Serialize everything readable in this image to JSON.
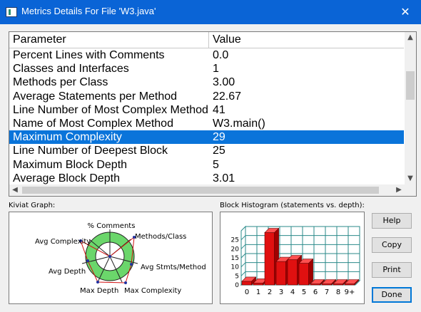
{
  "window": {
    "title": "Metrics Details For File 'W3.java'",
    "close_glyph": "✕"
  },
  "table": {
    "headers": {
      "parameter": "Parameter",
      "value": "Value"
    },
    "rows": [
      {
        "parameter": "Percent Lines with Comments",
        "value": "0.0"
      },
      {
        "parameter": "Classes and Interfaces",
        "value": "1"
      },
      {
        "parameter": "Methods per Class",
        "value": "3.00"
      },
      {
        "parameter": "Average Statements per Method",
        "value": "22.67"
      },
      {
        "parameter": "Line Number of Most Complex Method",
        "value": "41"
      },
      {
        "parameter": "Name of Most Complex Method",
        "value": "W3.main()"
      },
      {
        "parameter": "Maximum Complexity",
        "value": "29"
      },
      {
        "parameter": "Line Number of Deepest Block",
        "value": "25"
      },
      {
        "parameter": "Maximum Block Depth",
        "value": "5"
      },
      {
        "parameter": "Average Block Depth",
        "value": "3.01"
      }
    ],
    "selected_index": 6
  },
  "kiviat": {
    "label": "Kiviat Graph:",
    "axes": [
      "% Comments",
      "Methods/Class",
      "Avg Stmts/Method",
      "Max Complexity",
      "Max Depth",
      "Avg Depth",
      "Avg Complexity"
    ]
  },
  "histogram": {
    "label": "Block Histogram (statements vs. depth):",
    "y_ticks": [
      "0",
      "5",
      "10",
      "15",
      "20",
      "25"
    ],
    "x_ticks": [
      "0",
      "1",
      "2",
      "3",
      "4",
      "5",
      "6",
      "7",
      "8",
      "9+"
    ]
  },
  "buttons": {
    "help": "Help",
    "copy": "Copy",
    "print": "Print",
    "done": "Done"
  },
  "colors": {
    "titlebar": "#0a64d6",
    "selection": "#0a74da",
    "bar": "#e01010",
    "grid": "#2a8a8a",
    "kiviat_ring": "#6bd66b"
  },
  "chart_data": {
    "type": "bar",
    "title": "Block Histogram (statements vs. depth):",
    "xlabel": "",
    "ylabel": "",
    "categories": [
      "0",
      "1",
      "2",
      "3",
      "4",
      "5",
      "6",
      "7",
      "8",
      "9+"
    ],
    "values": [
      2,
      1,
      29,
      13,
      14,
      12,
      0,
      0,
      0,
      0
    ],
    "ylim": [
      0,
      30
    ]
  }
}
